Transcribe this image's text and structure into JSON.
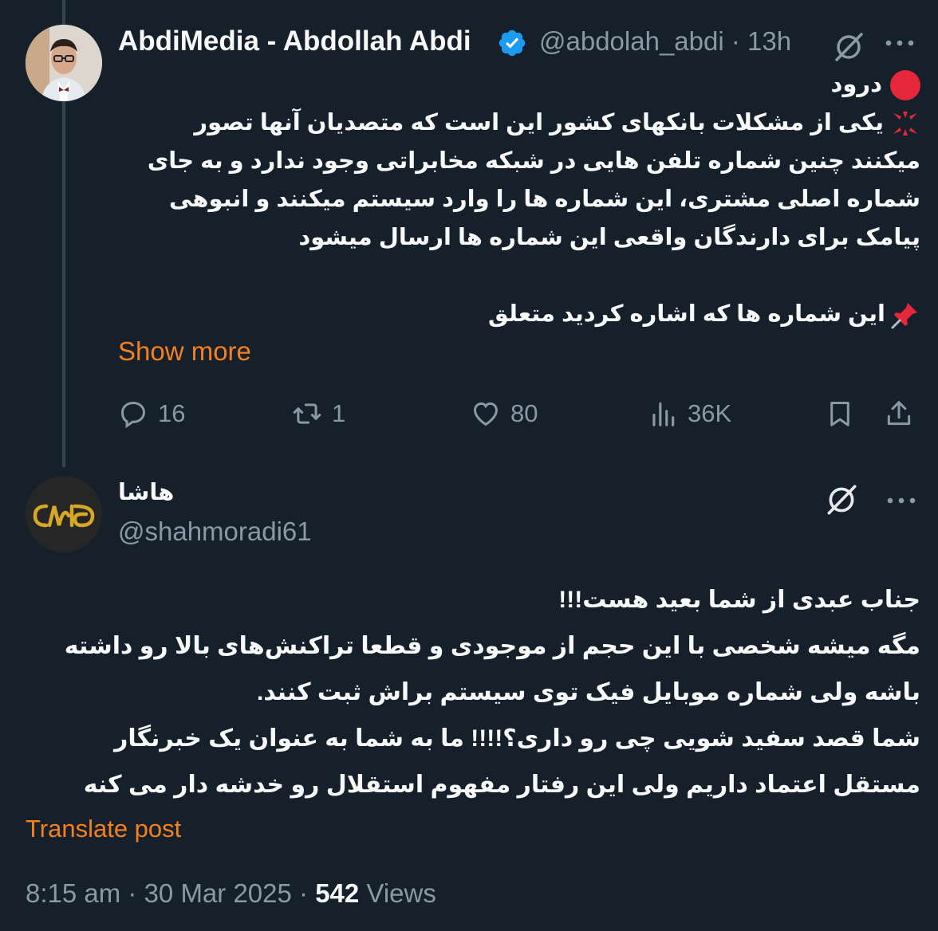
{
  "post": {
    "author_name": "AbdiMedia - Abdollah Abdi",
    "handle": "@abdolah_abdi",
    "sep": "·",
    "time": "13h",
    "lines": [
      "درود",
      "یکی از مشکلات بانکهای کشور این است که متصدیان آنها تصور میکنند چنین شماره تلفن هایی در شبکه مخابراتی وجود ندارد و به جای شماره اصلی مشتری، این شماره ها را وارد سیستم میکنند و انبوهی پیامک برای دارندگان واقعی این شماره ها ارسال میشود",
      "این شماره ها که اشاره کردید متعلق"
    ],
    "show_more": "Show more",
    "actions": {
      "replies": "16",
      "reposts": "1",
      "likes": "80",
      "views": "36K"
    }
  },
  "reply": {
    "author_name": "هاشا",
    "handle": "@shahmoradi61",
    "lines": [
      "جناب عبدی از شما بعید هست!!!",
      "مگه میشه شخصی با این حجم از موجودی و قطعا تراکنش‌های بالا رو داشته باشه ولی شماره موبایل فیک توی سیستم براش ثبت کنند.",
      "شما قصد سفید شویی چی رو داری؟!!!! ما به شما به عنوان یک خبرنگار مستقل اعتماد داریم ولی این رفتار مفهوم استقلال رو خدشه دار می کنه"
    ],
    "translate": "Translate post",
    "timestamp": "8:15 am · 30 Mar 2025 ·",
    "views_count": "542",
    "views_label": "Views"
  },
  "colors": {
    "accent": "#f4801e",
    "verified": "#1d9bf0",
    "background": "#15202b"
  }
}
